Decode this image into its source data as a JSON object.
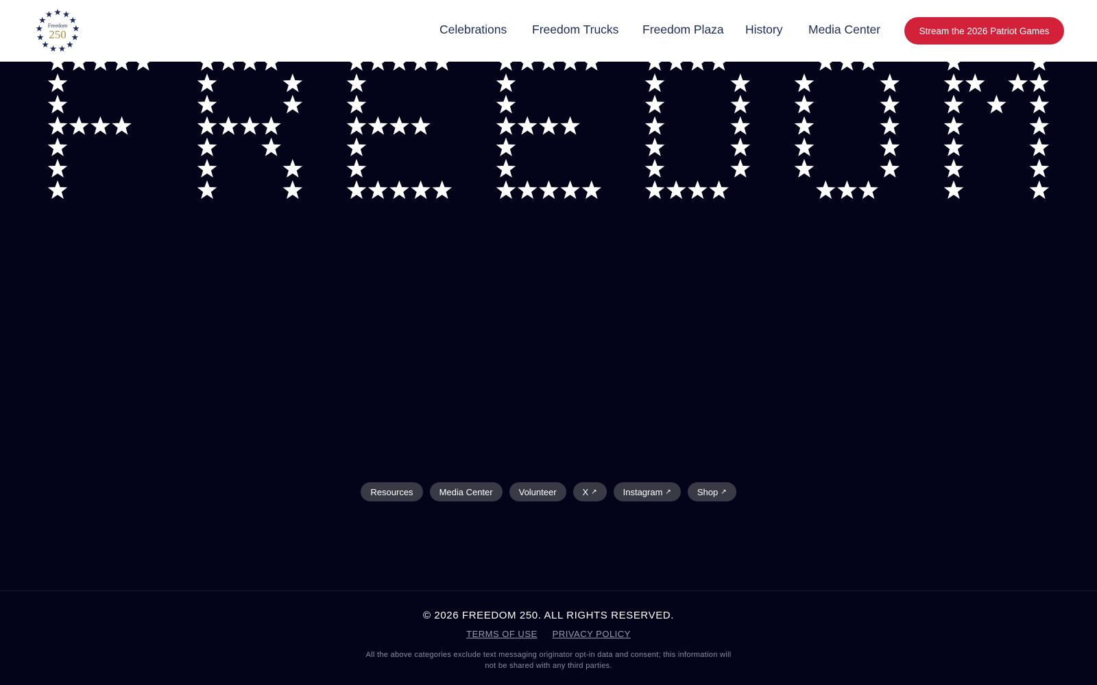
{
  "header": {
    "logo": {
      "top_text": "Freedom",
      "number": "250",
      "star_color": "#1c2d5c",
      "number_color": "#b08a3c"
    },
    "nav": [
      {
        "label": "Celebrations"
      },
      {
        "label": "Freedom Trucks"
      },
      {
        "label": "Freedom Plaza"
      },
      {
        "label": "History"
      },
      {
        "label": "Media Center"
      }
    ],
    "cta_label": "Stream the 2026 Patriot Games"
  },
  "hero": {
    "word": "FREEDOM",
    "star_color": "#ffffff"
  },
  "footer": {
    "pills": [
      {
        "label": "Resources",
        "external": false
      },
      {
        "label": "Media Center",
        "external": false
      },
      {
        "label": "Volunteer",
        "external": false
      },
      {
        "label": "X",
        "external": true
      },
      {
        "label": "Instagram",
        "external": true
      },
      {
        "label": "Shop",
        "external": true
      }
    ],
    "copyright": "© 2026 FREEDOM 250. ALL RIGHTS RESERVED.",
    "links": [
      {
        "label": "TERMS OF USE"
      },
      {
        "label": "PRIVACY POLICY"
      }
    ],
    "disclaimer": "All the above categories exclude text messaging originator opt-in data and consent; this information will not be shared with any third parties."
  },
  "colors": {
    "accent": "#d3213a",
    "navy": "#1c2d5c",
    "background": "#03031a"
  }
}
